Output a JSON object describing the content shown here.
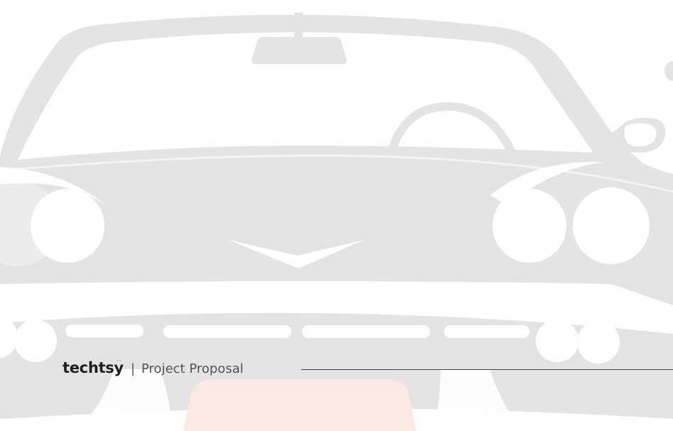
{
  "footer": {
    "brand": "techtsy",
    "brand_dots": "··",
    "separator": "|",
    "document_title": "Project Proposal"
  },
  "colors": {
    "brand_text": "#1f1f1f",
    "brand_accent": "#b5d334",
    "footer_text": "#555555",
    "rule": "#444444",
    "illustration": "#e4e4e6",
    "grille_accent": "#fde9e3"
  },
  "illustration": {
    "subject": "classic car front view"
  }
}
